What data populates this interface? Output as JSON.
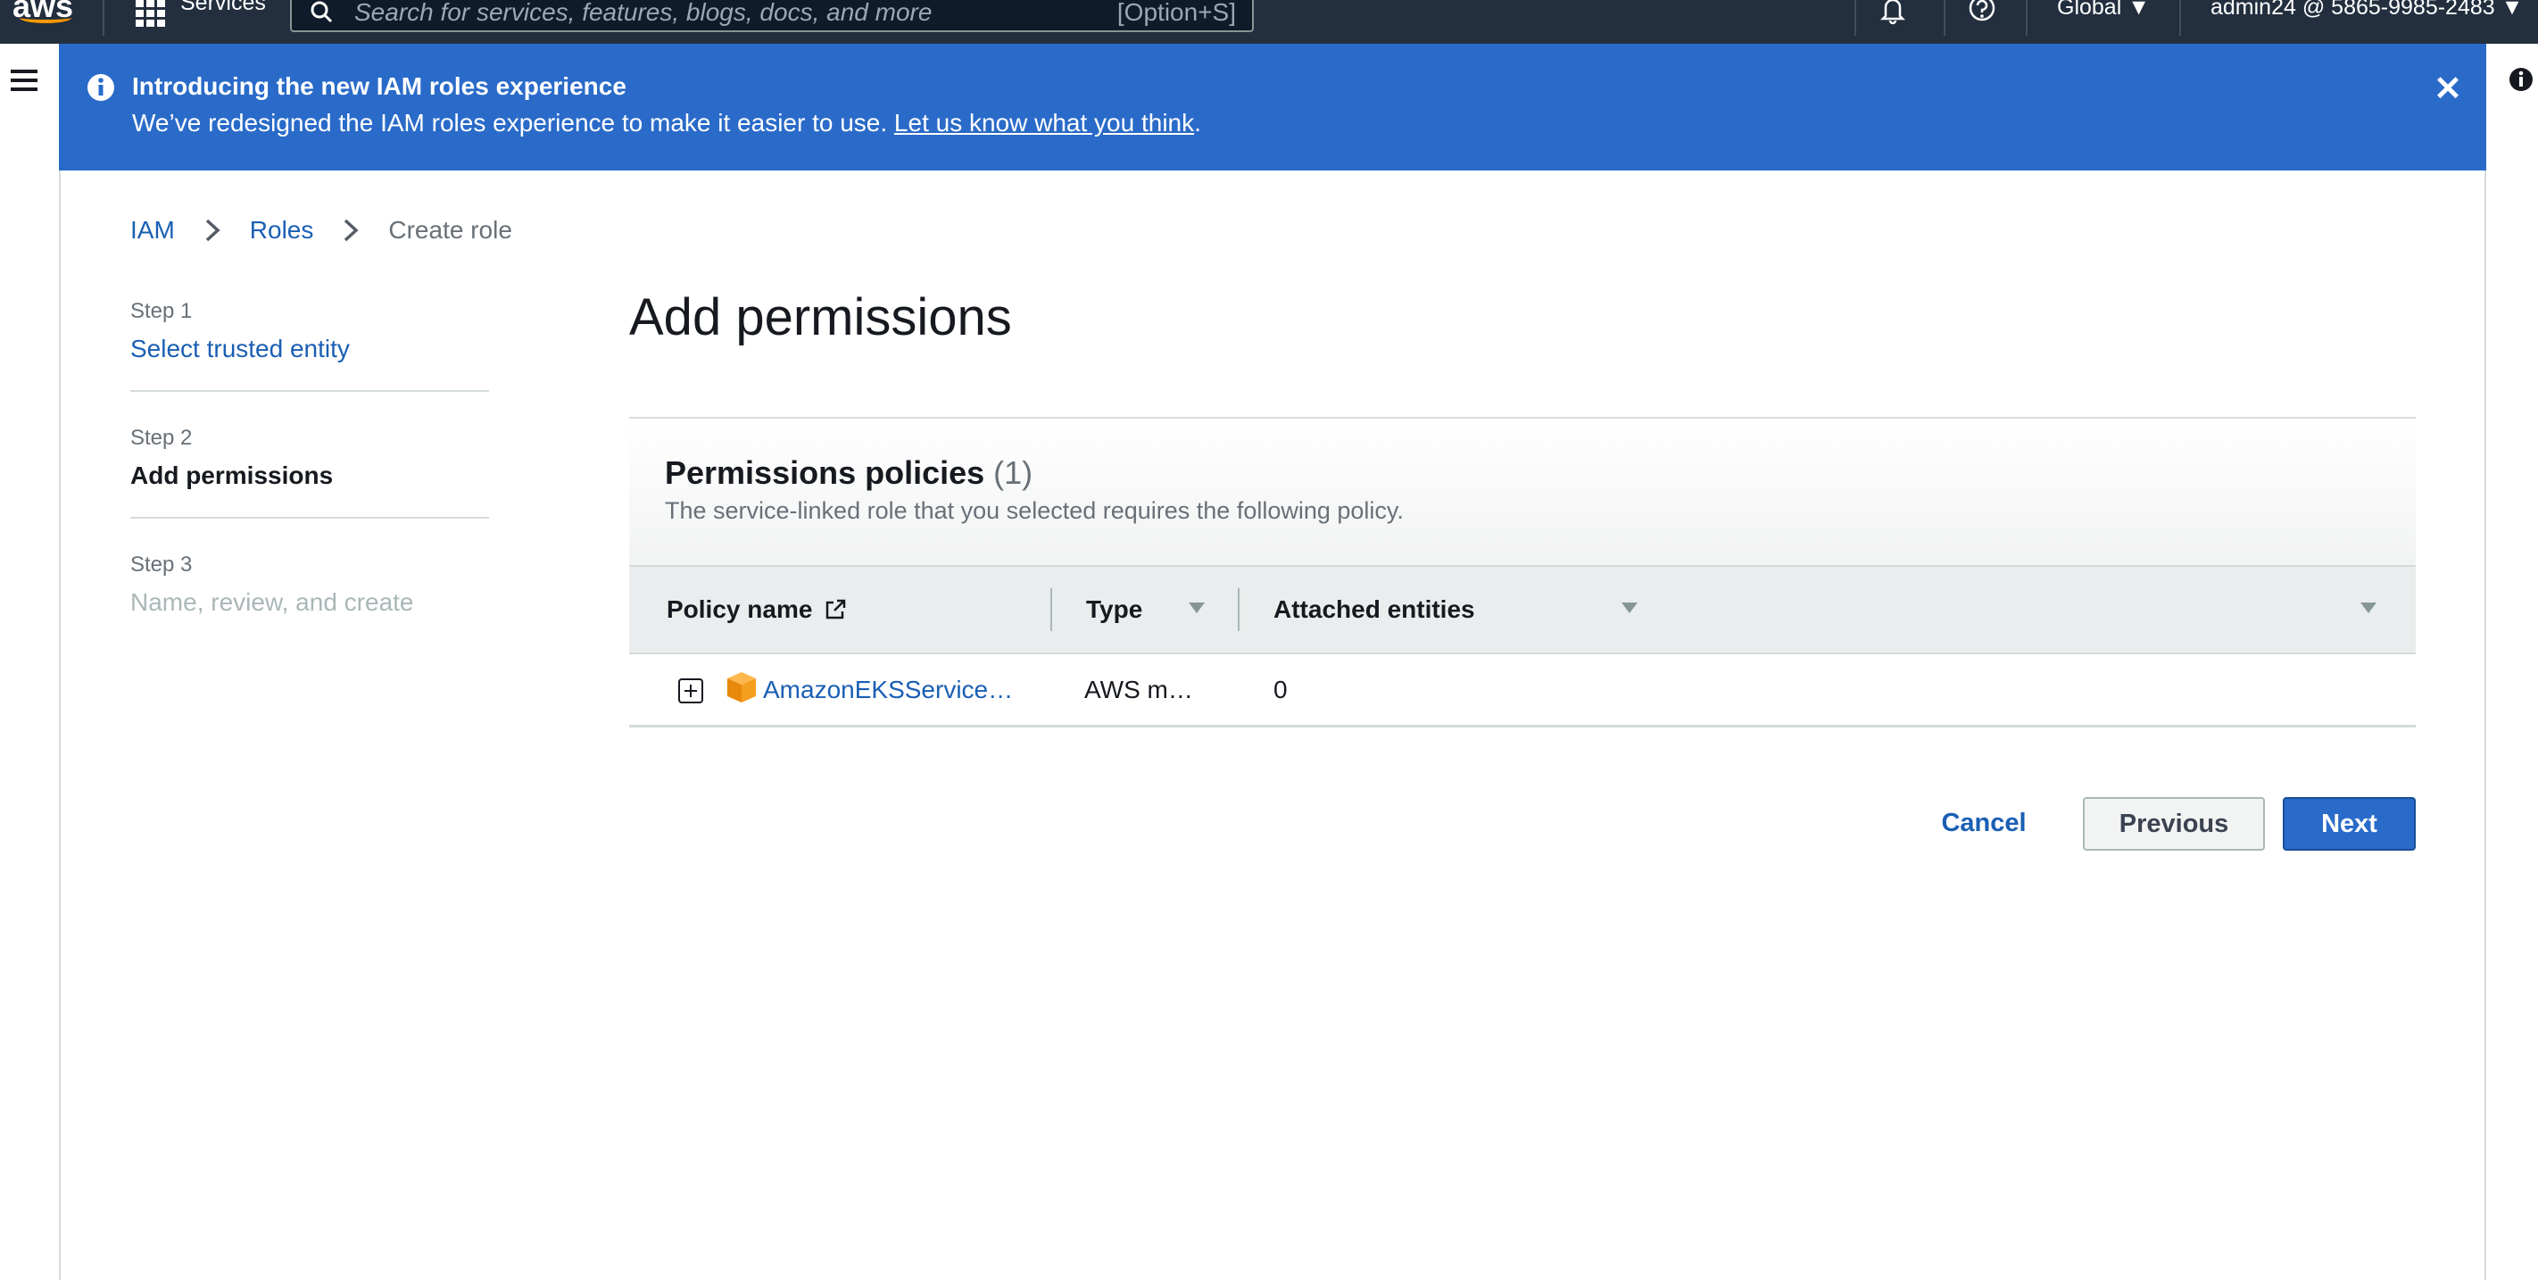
{
  "topnav": {
    "logo": "aws",
    "services_label": "Services",
    "search_placeholder": "Search for services, features, blogs, docs, and more",
    "search_shortcut": "[Option+S]",
    "region": "Global",
    "account": "admin24 @ 5865-9985-2483",
    "icons": [
      "services-grid-icon",
      "search-icon",
      "bell-icon",
      "help-icon",
      "caret-down-icon"
    ]
  },
  "banner": {
    "title": "Introducing the new IAM roles experience",
    "text": "We’ve redesigned the IAM roles experience to make it easier to use.",
    "link": "Let us know what you think",
    "after_link": ".",
    "color": "#2a6bc9"
  },
  "breadcrumb": {
    "items": [
      {
        "label": "IAM"
      },
      {
        "label": "Roles"
      },
      {
        "label": "Create role"
      }
    ]
  },
  "steps": [
    {
      "number": "Step 1",
      "title": "Select trusted entity",
      "state": "completed"
    },
    {
      "number": "Step 2",
      "title": "Add permissions",
      "state": "active"
    },
    {
      "number": "Step 3",
      "title": "Name, review, and create",
      "state": "disabled"
    }
  ],
  "main": {
    "title": "Add permissions",
    "panel": {
      "title": "Permissions policies",
      "count": "(1)",
      "description": "The service-linked role that you selected requires the following policy.",
      "columns": [
        {
          "label": "Policy name"
        },
        {
          "label": "Type"
        },
        {
          "label": "Attached entities"
        }
      ],
      "rows": [
        {
          "policy_name": "AmazonEKSService…",
          "type": "AWS m…",
          "attached_entities": "0"
        }
      ]
    }
  },
  "actions": {
    "cancel": "Cancel",
    "previous": "Previous",
    "next": "Next"
  }
}
